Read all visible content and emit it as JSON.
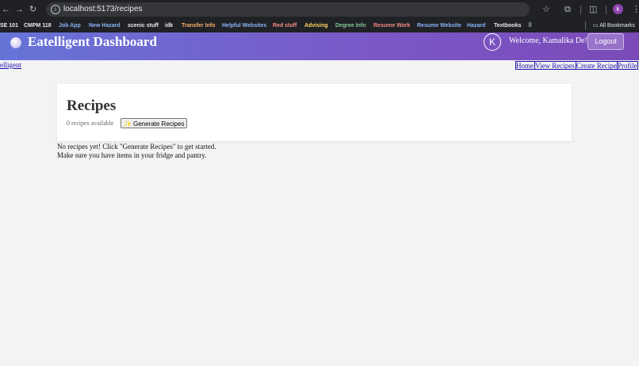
{
  "browser": {
    "url": "localhost:5173/recipes",
    "bookmarks": [
      {
        "label": "SE 101",
        "color": "#e8eaed"
      },
      {
        "label": "CMPM 118",
        "color": "#e8eaed"
      },
      {
        "label": "Job App",
        "color": "#8ab4f8"
      },
      {
        "label": "New Hazard",
        "color": "#8ab4f8"
      },
      {
        "label": "scenic stuff",
        "color": "#e8eaed"
      },
      {
        "label": "idk",
        "color": "#e8eaed"
      },
      {
        "label": "Transfer Info",
        "color": "#f6ae6b"
      },
      {
        "label": "Helpful Websites",
        "color": "#8ab4f8"
      },
      {
        "label": "Red stuff",
        "color": "#f28b82"
      },
      {
        "label": "Advising",
        "color": "#fdd663"
      },
      {
        "label": "Degree Info",
        "color": "#81c995"
      },
      {
        "label": "Resume Work",
        "color": "#f28b82"
      },
      {
        "label": "Resume Website",
        "color": "#8ab4f8"
      },
      {
        "label": "Hazard",
        "color": "#8ab4f8"
      },
      {
        "label": "Textbooks",
        "color": "#e8eaed"
      }
    ],
    "all_bookmarks": "All Bookmarks",
    "profile_initial": "k"
  },
  "header": {
    "title": "Eatelligent Dashboard",
    "avatar_initial": "K",
    "welcome": "Welcome, Kamalika De!",
    "logout": "Logout"
  },
  "subnav": {
    "brand": "elligent",
    "links": [
      "Home",
      "View Recipes",
      "Create Recipe",
      "Profile"
    ]
  },
  "main": {
    "title": "Recipes",
    "count": "0 recipes available",
    "generate_button": "Generate Recipes",
    "empty_line1": "No recipes yet! Click \"Generate Recipes\" to get started.",
    "empty_line2": "Make sure you have items in your fridge and pantry."
  }
}
